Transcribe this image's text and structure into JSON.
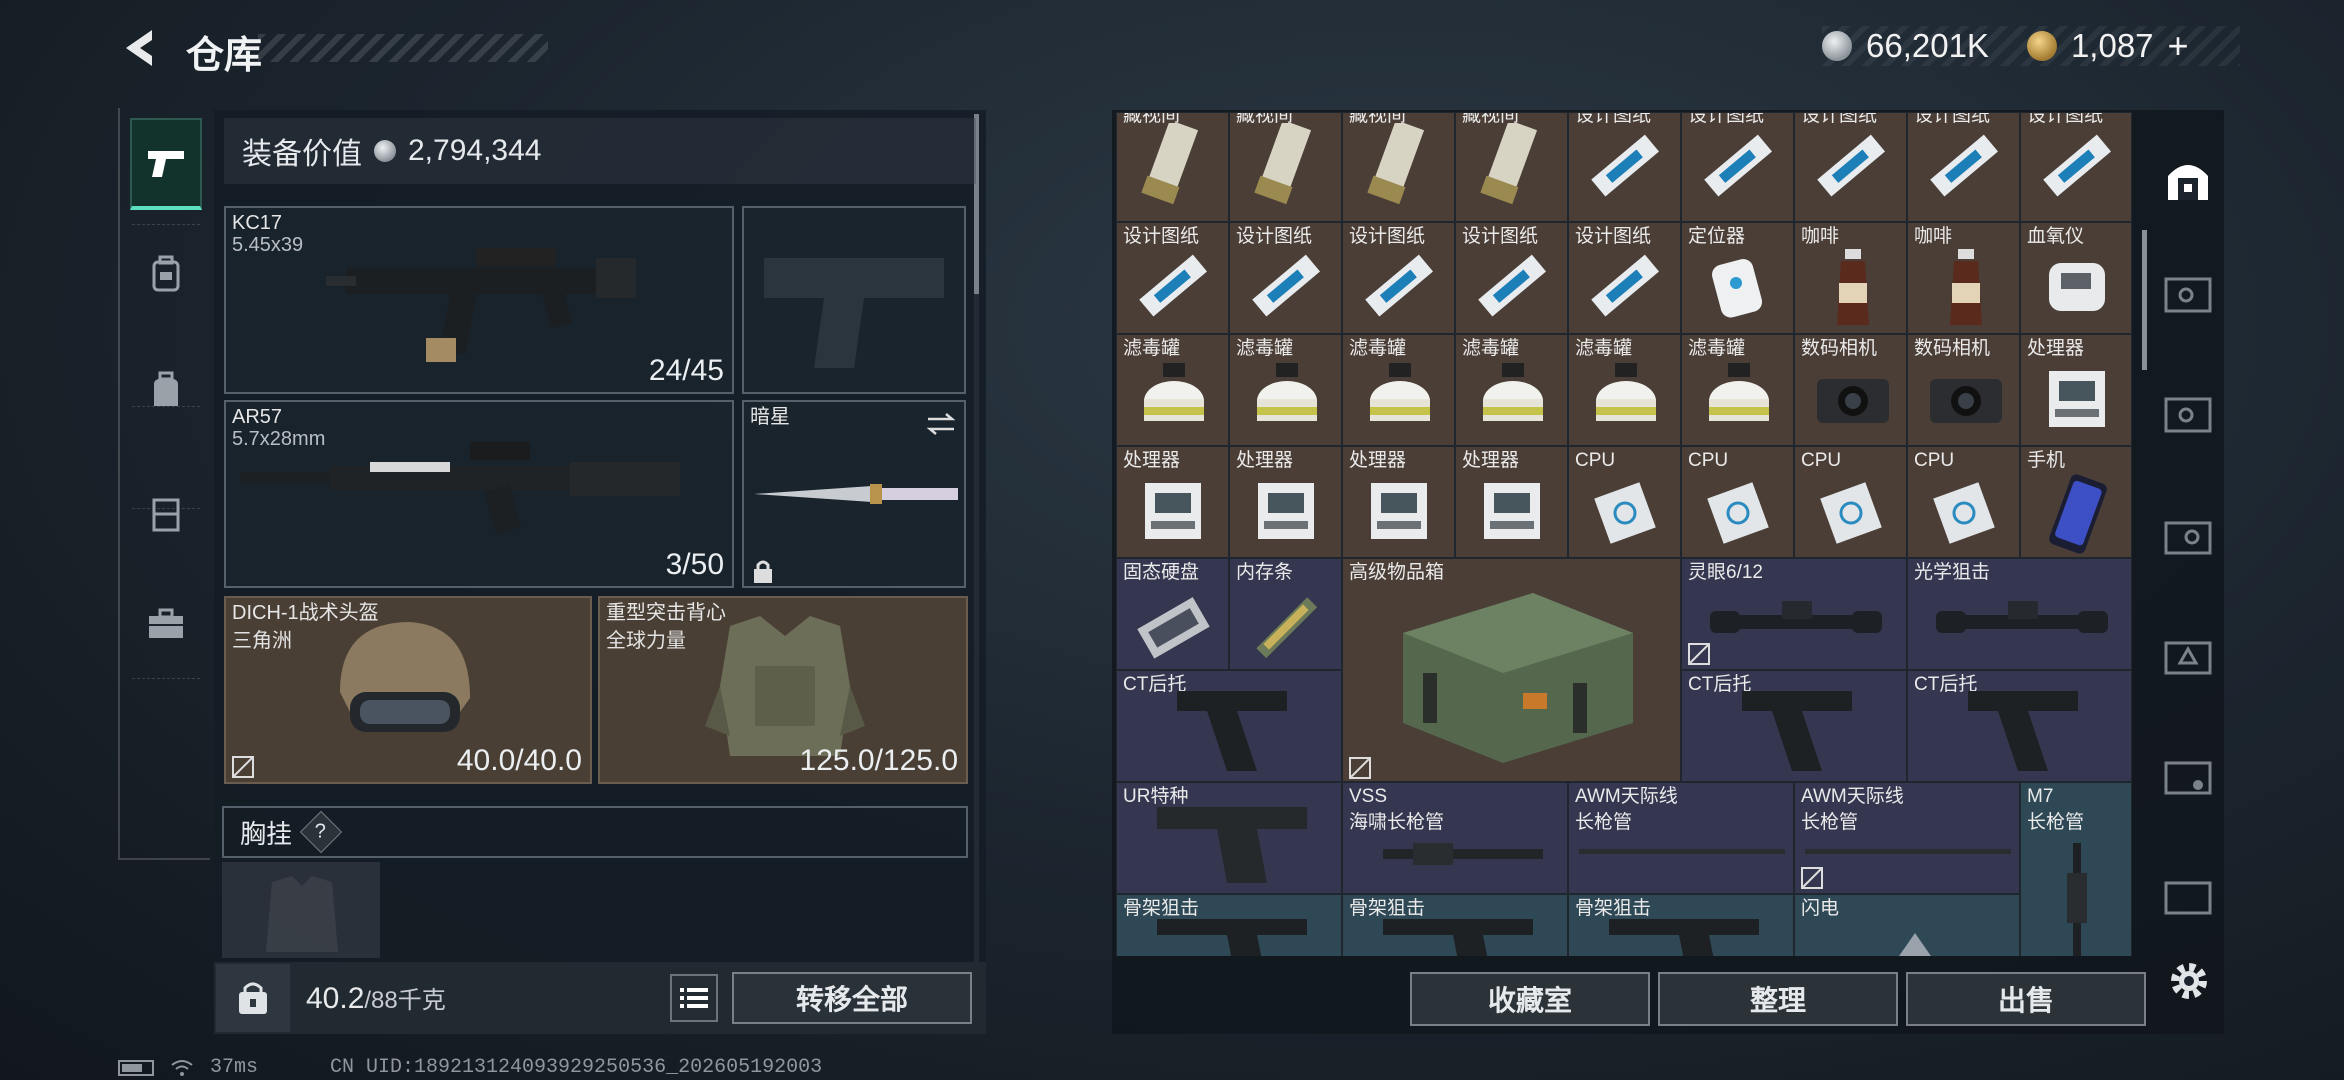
{
  "header": {
    "title": "仓库",
    "currency_silver": "66,201K",
    "currency_gold": "1,087",
    "gold_add": "+"
  },
  "equipment": {
    "value_label": "装备价值",
    "value": "2,794,344",
    "primary": {
      "name": "KC17",
      "ammo": "5.45x39",
      "count": "24/45"
    },
    "secondary": {
      "name": "AR57",
      "ammo": "5.7x28mm",
      "count": "3/50"
    },
    "melee": {
      "name": "暗星"
    },
    "helmet": {
      "name": "DICH-1战术头盔",
      "sub": "三角洲",
      "durability": "40.0/40.0"
    },
    "armor": {
      "name": "重型突击背心",
      "sub": "全球力量",
      "durability": "125.0/125.0"
    },
    "chest_rig_label": "胸挂",
    "chest_rig_help": "?"
  },
  "weight": {
    "current": "40.2",
    "unit": "/88千克"
  },
  "buttons": {
    "transfer_all": "转移全部",
    "collection": "收藏室",
    "organize": "整理",
    "sell": "出售"
  },
  "grid": {
    "row0": [
      "藏视间",
      "藏视间",
      "藏视间",
      "藏视间",
      "设计图纸",
      "设计图纸",
      "设计图纸",
      "设计图纸",
      "设计图纸"
    ],
    "row1": [
      "设计图纸",
      "设计图纸",
      "设计图纸",
      "设计图纸",
      "设计图纸",
      "定位器",
      "咖啡",
      "咖啡",
      "血氧仪"
    ],
    "row2": [
      "滤毒罐",
      "滤毒罐",
      "滤毒罐",
      "滤毒罐",
      "滤毒罐",
      "滤毒罐",
      "数码相机",
      "数码相机",
      "处理器"
    ],
    "row3": [
      "处理器",
      "处理器",
      "处理器",
      "处理器",
      "CPU",
      "CPU",
      "CPU",
      "CPU",
      "手机"
    ],
    "ssd": "固态硬盘",
    "ram": "内存条",
    "crate": "高级物品箱",
    "scope1": "灵眼6/12",
    "scope2": "光学狙击",
    "stock1": "CT后托",
    "stock2": "CT后托",
    "stock3": "CT后托",
    "ur_stock": "UR特种",
    "vss_name": "VSS",
    "vss_sub": "海啸长枪管",
    "awm1_name": "AWM天际线",
    "awm1_sub": "长枪管",
    "awm2_name": "AWM天际线",
    "awm2_sub": "长枪管",
    "m7_name": "M7",
    "m7_sub": "长枪管",
    "skeleton1": "骨架狙击",
    "skeleton2": "骨架狙击",
    "skeleton3": "骨架狙击",
    "flash": "闪电"
  },
  "status": {
    "ping": "37ms",
    "uid": "CN UID:189213124093929250536_202605192003"
  },
  "colors": {
    "accent": "#5ee0c0",
    "cell_brown": "#4b3e37",
    "cell_purple": "#353750",
    "cell_blue": "#2e4856"
  }
}
